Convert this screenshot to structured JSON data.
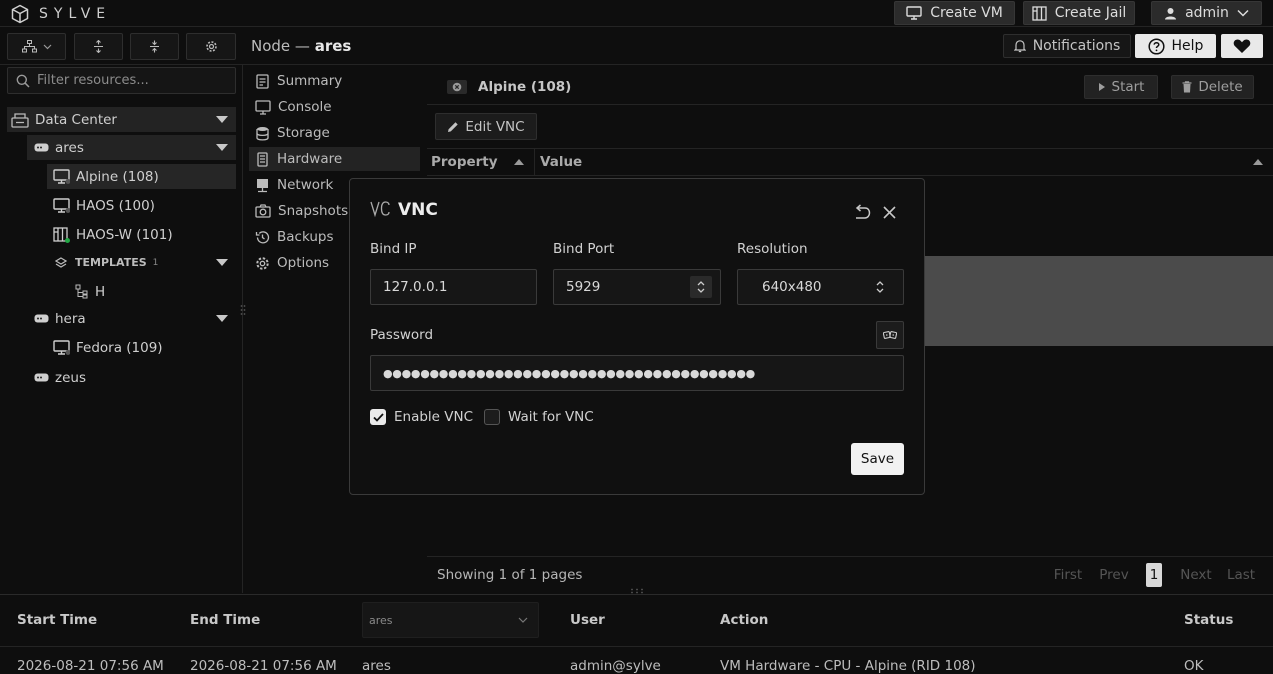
{
  "app": {
    "logo_text": "SYLVE"
  },
  "topbar": {
    "create_vm": "Create VM",
    "create_jail": "Create Jail",
    "user": "admin"
  },
  "header": {
    "node_prefix": "Node —",
    "node_name": "ares",
    "notifications": "Notifications",
    "help": "Help"
  },
  "filter": {
    "placeholder": "Filter resources..."
  },
  "tree": {
    "datacenter": "Data Center",
    "node_ares": "ares",
    "vm_alpine": "Alpine (108)",
    "vm_haos": "HAOS (100)",
    "vm_haosw": "HAOS-W (101)",
    "templates": "TEMPLATES",
    "templates_count": "1",
    "template_h": "H",
    "node_hera": "hera",
    "vm_fedora": "Fedora (109)",
    "node_zeus": "zeus"
  },
  "menu": {
    "summary": "Summary",
    "console": "Console",
    "storage": "Storage",
    "hardware": "Hardware",
    "network": "Network",
    "snapshots": "Snapshots",
    "backups": "Backups",
    "options": "Options"
  },
  "vm": {
    "title": "Alpine (108)",
    "start": "Start",
    "delete": "Delete",
    "edit_vnc": "Edit VNC"
  },
  "table": {
    "col_property": "Property",
    "col_value": "Value",
    "showing": "Showing 1 of 1 pages"
  },
  "pagination": {
    "first": "First",
    "prev": "Prev",
    "current": "1",
    "next": "Next",
    "last": "Last"
  },
  "modal": {
    "title": "VNC",
    "bind_ip_label": "Bind IP",
    "bind_ip": "127.0.0.1",
    "bind_port_label": "Bind Port",
    "bind_port": "5929",
    "resolution_label": "Resolution",
    "resolution": "640x480",
    "password_label": "Password",
    "password": "●●●●●●●●●●●●●●●●●●●●●●●●●●●●●●●●●●●●●●●●",
    "enable_vnc": "Enable VNC",
    "enable_vnc_checked": true,
    "wait_vnc": "Wait for VNC",
    "wait_vnc_checked": false,
    "save": "Save"
  },
  "log": {
    "headers": {
      "start": "Start Time",
      "end": "End Time",
      "node_filter": "ares",
      "user": "User",
      "action": "Action",
      "status": "Status"
    },
    "row": {
      "start": "2026-08-21 07:56 AM",
      "end": "2026-08-21 07:56 AM",
      "node": "ares",
      "user": "admin@sylve",
      "action": "VM Hardware - CPU - Alpine (RID 108)",
      "status": "OK"
    }
  },
  "colors": {
    "bg": "#0e0e0e",
    "panel": "#232323",
    "accent_green": "#22a845",
    "save_bg": "#f2f2f2"
  }
}
